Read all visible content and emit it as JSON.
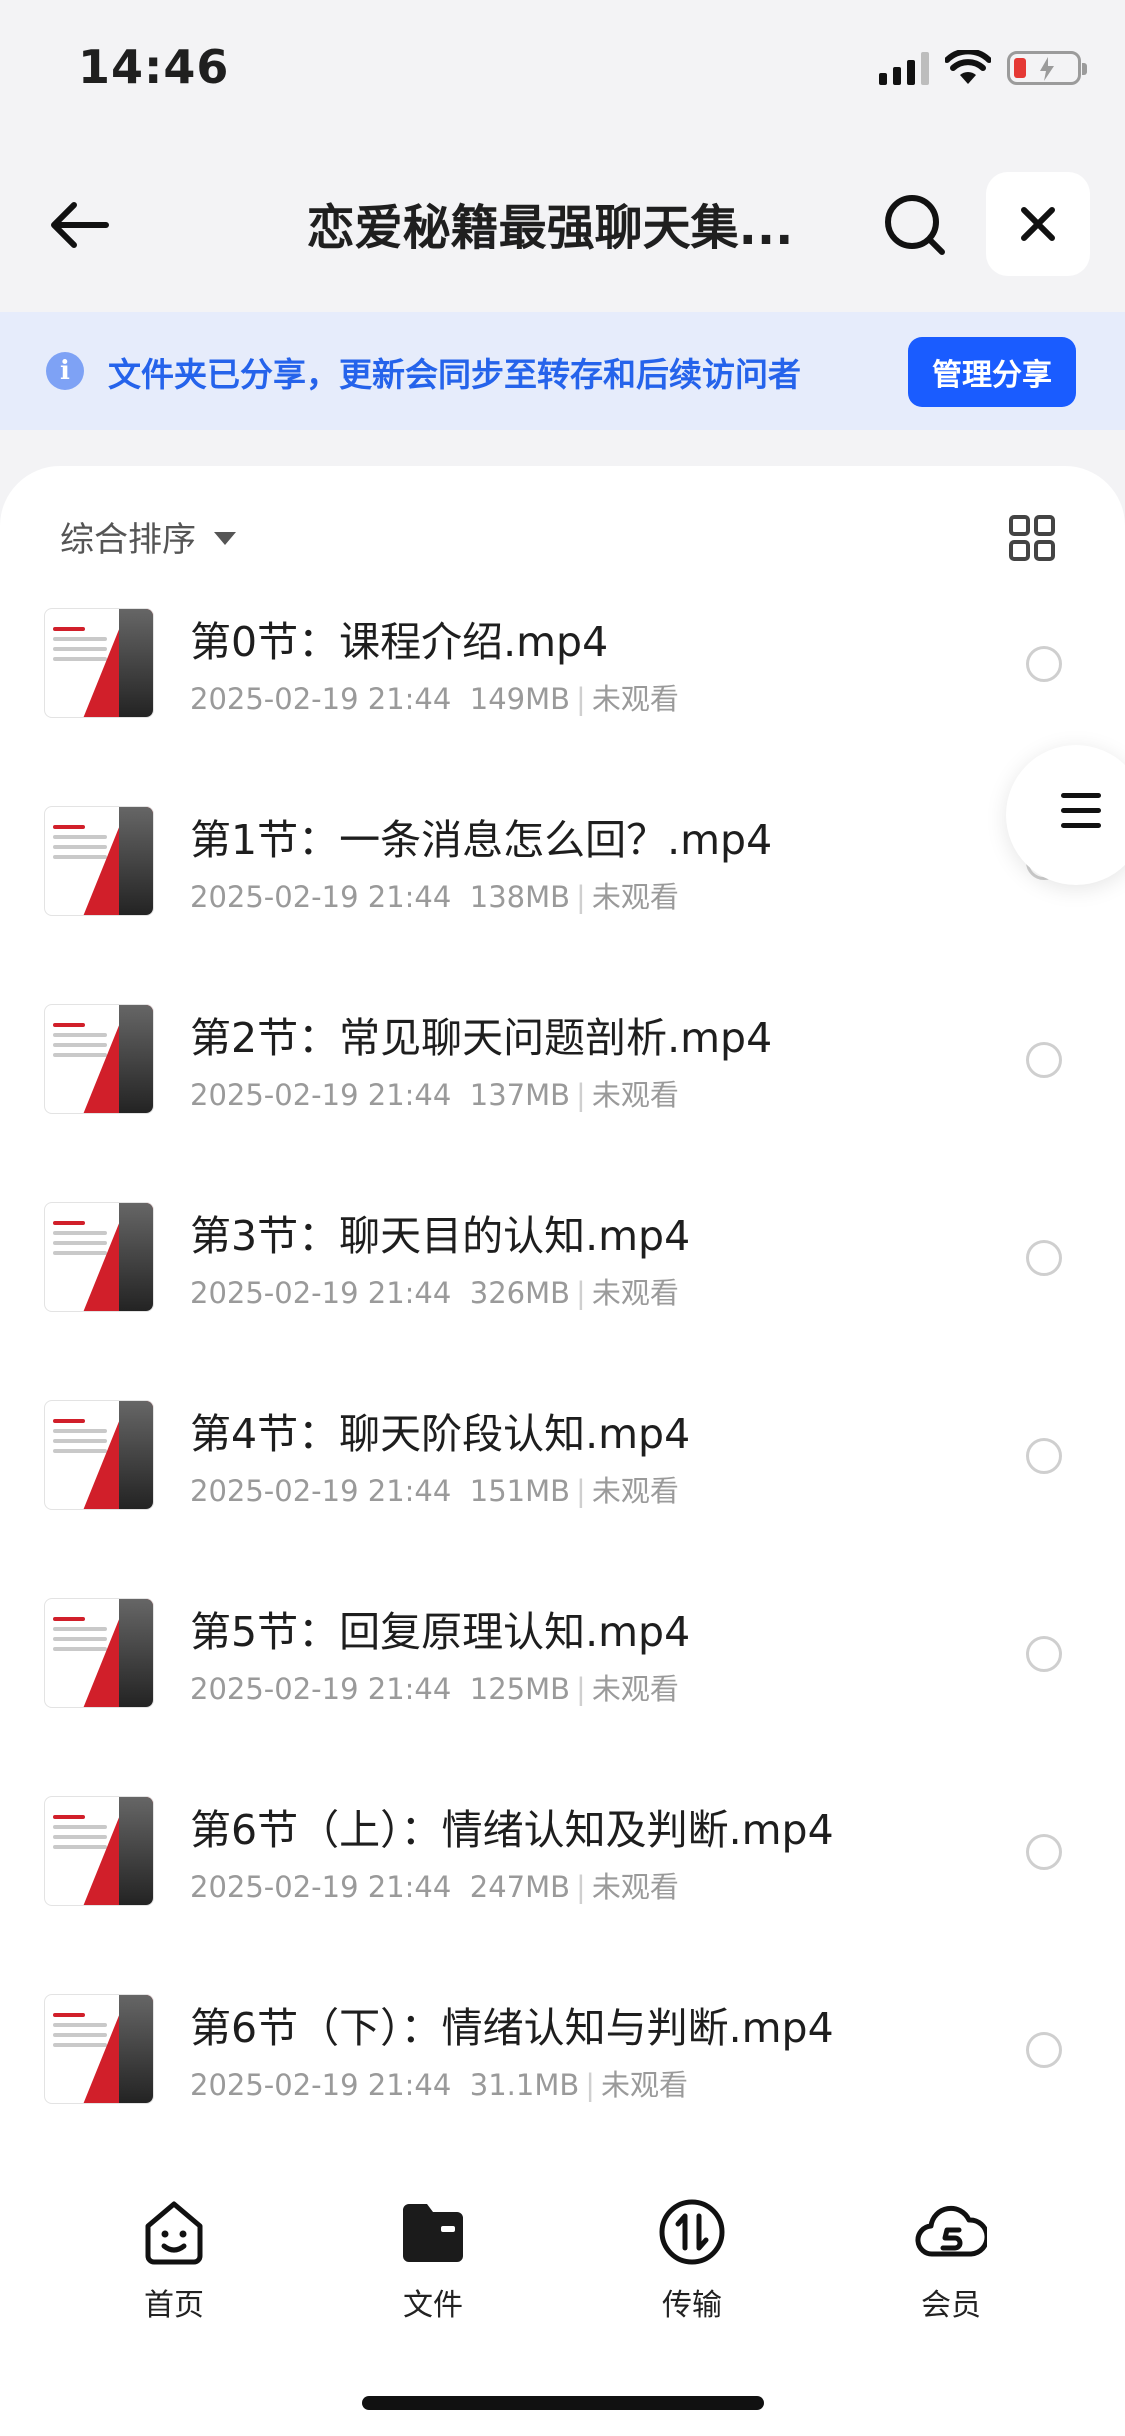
{
  "status_bar": {
    "time": "14:46"
  },
  "nav": {
    "title": "恋爱秘籍最强聊天集..."
  },
  "share_banner": {
    "text": "文件夹已分享，更新会同步至转存和后续访问者",
    "button_label": "管理分享"
  },
  "sort": {
    "label": "综合排序"
  },
  "files": [
    {
      "name": "第0节：课程介绍.mp4",
      "date": "2025-02-19 21:44",
      "size": "149MB",
      "status": "未观看"
    },
    {
      "name": "第1节：一条消息怎么回？.mp4",
      "date": "2025-02-19 21:44",
      "size": "138MB",
      "status": "未观看"
    },
    {
      "name": "第2节：常见聊天问题剖析.mp4",
      "date": "2025-02-19 21:44",
      "size": "137MB",
      "status": "未观看"
    },
    {
      "name": "第3节：聊天目的认知.mp4",
      "date": "2025-02-19 21:44",
      "size": "326MB",
      "status": "未观看"
    },
    {
      "name": "第4节：聊天阶段认知.mp4",
      "date": "2025-02-19 21:44",
      "size": "151MB",
      "status": "未观看"
    },
    {
      "name": "第5节：回复原理认知.mp4",
      "date": "2025-02-19 21:44",
      "size": "125MB",
      "status": "未观看"
    },
    {
      "name": "第6节（上）：情绪认知及判断.mp4",
      "date": "2025-02-19 21:44",
      "size": "247MB",
      "status": "未观看"
    },
    {
      "name": "第6节（下）：情绪认知与判断.mp4",
      "date": "2025-02-19 21:44",
      "size": "31.1MB",
      "status": "未观看"
    }
  ],
  "tabs": [
    {
      "label": "首页",
      "icon": "smile-face-icon"
    },
    {
      "label": "文件",
      "icon": "folder-icon"
    },
    {
      "label": "传输",
      "icon": "transfer-icon"
    },
    {
      "label": "会员",
      "icon": "cloud-vip-icon"
    }
  ],
  "colors": {
    "accent": "#1a5cff",
    "banner_bg": "#e6ecfb",
    "banner_text": "#2563eb"
  }
}
